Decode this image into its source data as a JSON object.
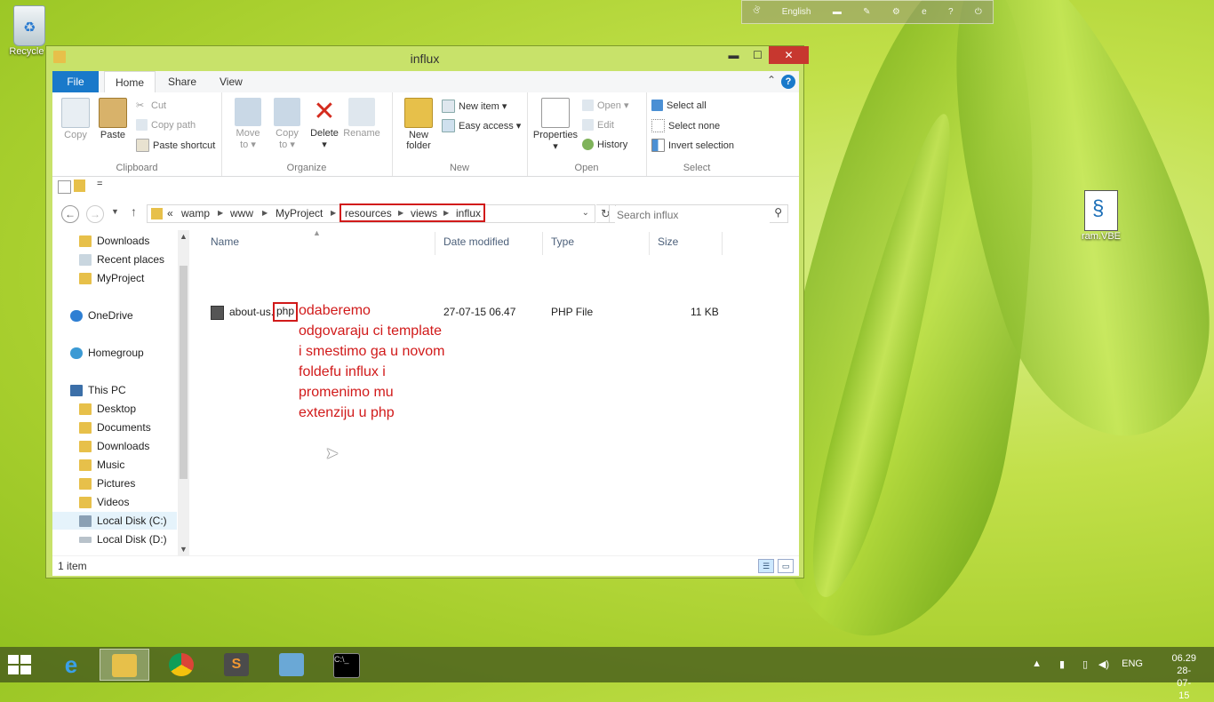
{
  "desktop": {
    "icons": [
      {
        "label": "Recycle I"
      },
      {
        "label": "ram.VBE"
      }
    ]
  },
  "language_bar": {
    "language": "English"
  },
  "window": {
    "title": "influx",
    "controls": {
      "minimize": "▬",
      "maximize": "☐",
      "close": "✕"
    }
  },
  "ribbon_tabs": [
    "File",
    "Home",
    "Share",
    "View"
  ],
  "ribbon": {
    "clipboard": {
      "label": "Clipboard",
      "copy": "Copy",
      "paste": "Paste",
      "cut": "Cut",
      "copy_path": "Copy path",
      "paste_shortcut": "Paste shortcut"
    },
    "organize": {
      "label": "Organize",
      "move_to_1": "Move",
      "move_to_2": "to ▾",
      "copy_to_1": "Copy",
      "copy_to_2": "to ▾",
      "delete": "Delete",
      "delete_arrow": "▾",
      "rename": "Rename"
    },
    "new": {
      "label": "New",
      "new_folder_1": "New",
      "new_folder_2": "folder",
      "new_item": "New item ▾",
      "easy_access": "Easy access ▾"
    },
    "open": {
      "label": "Open",
      "properties": "Properties",
      "properties_arrow": "▾",
      "open": "Open ▾",
      "edit": "Edit",
      "history": "History"
    },
    "select": {
      "label": "Select",
      "select_all": "Select all",
      "select_none": "Select none",
      "invert": "Invert selection"
    }
  },
  "quick_access": {
    "customize": "="
  },
  "address": {
    "prefix": "«",
    "crumbs": [
      "wamp",
      "www",
      "MyProject",
      "resources",
      "views",
      "influx"
    ],
    "search_placeholder": "Search influx"
  },
  "nav_pane": {
    "items": [
      {
        "label": "Downloads",
        "icon": "folder-icon"
      },
      {
        "label": "Recent places",
        "icon": "recent-icon"
      },
      {
        "label": "MyProject",
        "icon": "folder-icon"
      },
      {
        "label": "OneDrive",
        "icon": "cloud-icon"
      },
      {
        "label": "Homegroup",
        "icon": "homegroup-icon"
      },
      {
        "label": "This PC",
        "icon": "computer-icon"
      },
      {
        "label": "Desktop",
        "icon": "folder-icon"
      },
      {
        "label": "Documents",
        "icon": "folder-icon"
      },
      {
        "label": "Downloads",
        "icon": "folder-icon"
      },
      {
        "label": "Music",
        "icon": "folder-icon"
      },
      {
        "label": "Pictures",
        "icon": "folder-icon"
      },
      {
        "label": "Videos",
        "icon": "folder-icon"
      },
      {
        "label": "Local Disk (C:)",
        "icon": "drive-icon"
      },
      {
        "label": "Local Disk (D:)",
        "icon": "drive-icon"
      }
    ]
  },
  "file_list": {
    "columns": [
      "Name",
      "Date modified",
      "Type",
      "Size"
    ],
    "rows": [
      {
        "name_base": "about-us.",
        "name_ext": "php",
        "date": "27-07-15 06.47",
        "type": "PHP File",
        "size": "11 KB"
      }
    ]
  },
  "annotation": {
    "lines": [
      "odaberemo",
      "odgovaraju ci template",
      "i smestimo ga u novom",
      "foldefu influx i",
      "promenimo mu",
      "extenziju u php"
    ]
  },
  "status": {
    "item_count": "1 item"
  },
  "taskbar": {
    "tray_lang": "ENG",
    "time": "06.29",
    "date": "28-07-15"
  },
  "colors": {
    "accent": "#1979ca",
    "highlight": "#d11a1a"
  }
}
